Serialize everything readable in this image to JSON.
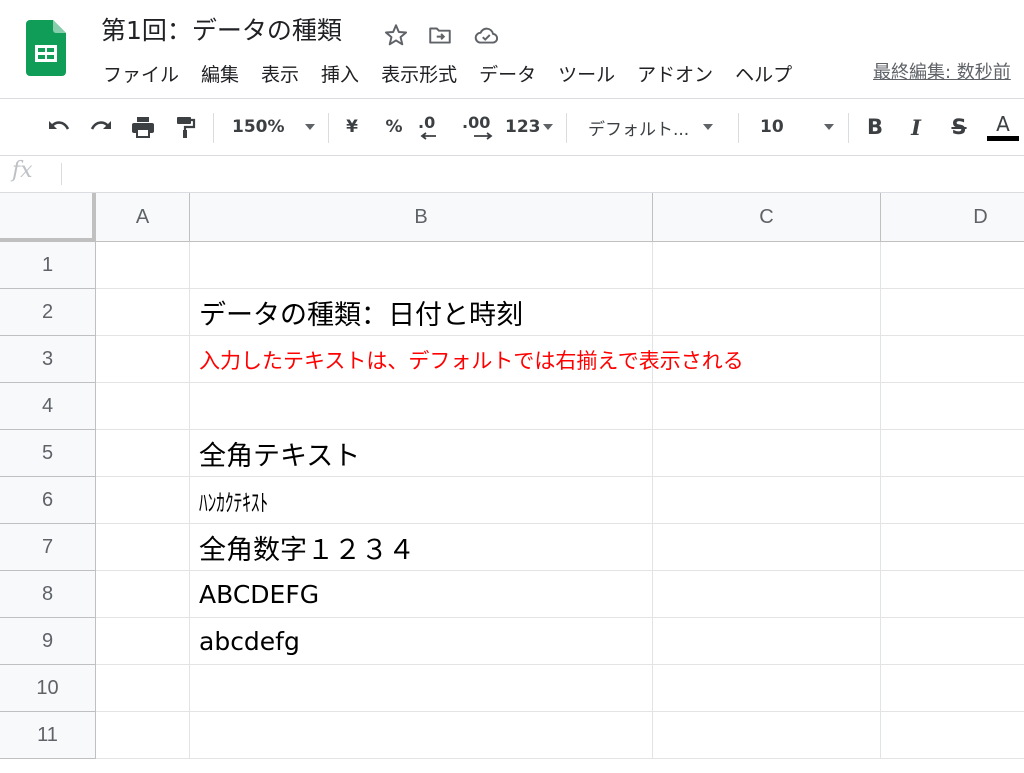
{
  "app": {
    "logo_icon": "sheets-logo-icon",
    "accent_color": "#0f9d58"
  },
  "title": "第1回：データの種類",
  "title_icons": [
    "star-icon",
    "move-to-folder-icon",
    "cloud-saved-icon"
  ],
  "menu": [
    "ファイル",
    "編集",
    "表示",
    "挿入",
    "表示形式",
    "データ",
    "ツール",
    "アドオン",
    "ヘルプ"
  ],
  "last_edit": "最終編集: 数秒前",
  "toolbar": {
    "zoom": "150%",
    "currency": "¥",
    "percent": "%",
    "decimal_decrease": ".0",
    "decimal_increase": ".00",
    "more_formats": "123",
    "font": "デフォルト...",
    "font_size": "10",
    "bold": "B",
    "italic": "I",
    "strike": "S",
    "text_color_label": "A",
    "text_color": "#000000"
  },
  "formula_bar": {
    "label": "fx",
    "value": ""
  },
  "columns": [
    "A",
    "B",
    "C",
    "D"
  ],
  "rows": [
    "1",
    "2",
    "3",
    "4",
    "5",
    "6",
    "7",
    "8",
    "9",
    "10",
    "11"
  ],
  "cells": {
    "B2": "データの種類：日付と時刻",
    "B3": "入力したテキストは、デフォルトでは右揃えで表示される",
    "B5": "全角テキスト",
    "B6": "ﾊﾝｶｸﾃｷｽﾄ",
    "B7": "全角数字１２３４",
    "B8": "ABCDEFG",
    "B9": "abcdefg"
  },
  "note_color": "#ff0000"
}
